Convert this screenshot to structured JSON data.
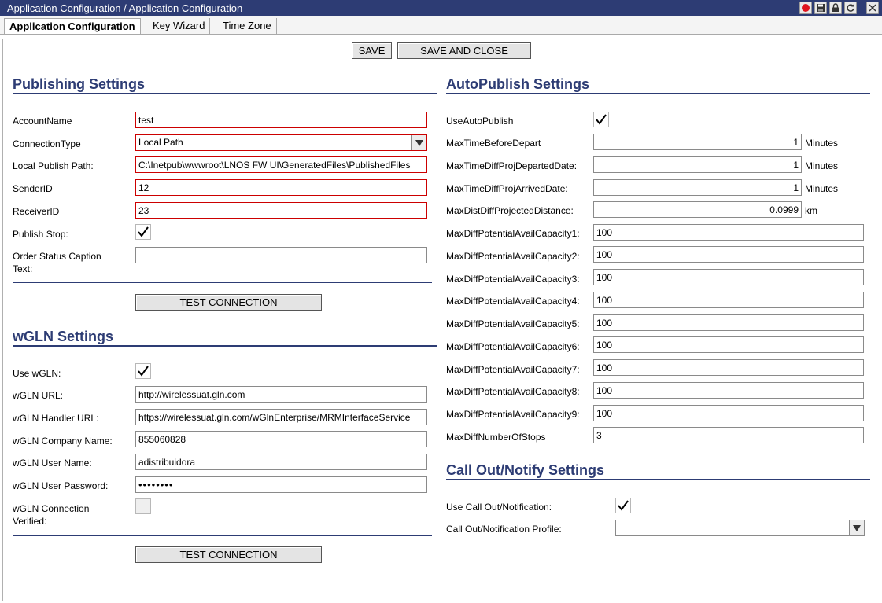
{
  "window": {
    "title": "Application Configuration / Application Configuration",
    "controls": [
      "record-icon",
      "save-icon",
      "lock-icon",
      "refresh-icon",
      "close-icon"
    ]
  },
  "tabs": [
    {
      "label": "Application Configuration",
      "active": true
    },
    {
      "label": "Key Wizard",
      "active": false
    },
    {
      "label": "Time Zone",
      "active": false
    }
  ],
  "toolbar": {
    "save_label": "SAVE",
    "save_close_label": "SAVE AND CLOSE"
  },
  "publishing": {
    "title": "Publishing Settings",
    "account_name": {
      "label": "AccountName",
      "value": "test"
    },
    "connection_type": {
      "label": "ConnectionType",
      "value": "Local Path"
    },
    "local_publish_path": {
      "label": "Local Publish Path:",
      "value": "C:\\Inetpub\\wwwroot\\LNOS FW UI\\GeneratedFiles\\PublishedFiles"
    },
    "sender_id": {
      "label": "SenderID",
      "value": "12"
    },
    "receiver_id": {
      "label": "ReceiverID",
      "value": "23"
    },
    "publish_stop": {
      "label": "Publish Stop:",
      "checked": true
    },
    "order_status_caption": {
      "label": "Order Status Caption Text:",
      "value": ""
    },
    "test_label": "TEST CONNECTION"
  },
  "wgln": {
    "title": "wGLN Settings",
    "use_wgln": {
      "label": "Use wGLN:",
      "checked": true
    },
    "url": {
      "label": "wGLN URL:",
      "value": "http://wirelessuat.gln.com"
    },
    "handler_url": {
      "label": "wGLN Handler URL:",
      "value": "https://wirelessuat.gln.com/wGlnEnterprise/MRMInterfaceService"
    },
    "company_name": {
      "label": "wGLN Company Name:",
      "value": "855060828"
    },
    "user_name": {
      "label": "wGLN User Name:",
      "value": "adistribuidora"
    },
    "user_password": {
      "label": "wGLN User Password:",
      "value": "••••••••"
    },
    "connection_verified": {
      "label": "wGLN Connection Verified:",
      "checked": false
    },
    "test_label": "TEST CONNECTION"
  },
  "autopublish": {
    "title": "AutoPublish Settings",
    "use_autopublish": {
      "label": "UseAutoPublish",
      "checked": true
    },
    "max_time_before_depart": {
      "label": "MaxTimeBeforeDepart",
      "value": "1",
      "unit": "Minutes"
    },
    "max_time_diff_departed": {
      "label": "MaxTimeDiffProjDepartedDate:",
      "value": "1",
      "unit": "Minutes"
    },
    "max_time_diff_arrived": {
      "label": "MaxTimeDiffProjArrivedDate:",
      "value": "1",
      "unit": "Minutes"
    },
    "max_dist_diff": {
      "label": "MaxDistDiffProjectedDistance:",
      "value": "0.0999",
      "unit": "km"
    },
    "capacity": [
      {
        "label": "MaxDiffPotentialAvailCapacity1:",
        "value": "100"
      },
      {
        "label": "MaxDiffPotentialAvailCapacity2:",
        "value": "100"
      },
      {
        "label": "MaxDiffPotentialAvailCapacity3:",
        "value": "100"
      },
      {
        "label": "MaxDiffPotentialAvailCapacity4:",
        "value": "100"
      },
      {
        "label": "MaxDiffPotentialAvailCapacity5:",
        "value": "100"
      },
      {
        "label": "MaxDiffPotentialAvailCapacity6:",
        "value": "100"
      },
      {
        "label": "MaxDiffPotentialAvailCapacity7:",
        "value": "100"
      },
      {
        "label": "MaxDiffPotentialAvailCapacity8:",
        "value": "100"
      },
      {
        "label": "MaxDiffPotentialAvailCapacity9:",
        "value": "100"
      }
    ],
    "max_diff_stops": {
      "label": "MaxDiffNumberOfStops",
      "value": "3"
    }
  },
  "callout": {
    "title": "Call Out/Notify Settings",
    "use_callout": {
      "label": "Use Call Out/Notification:",
      "checked": true
    },
    "profile": {
      "label": "Call Out/Notification Profile:",
      "value": ""
    }
  },
  "colors": {
    "title_bar": "#2d3c74",
    "section_title": "#2d3c74",
    "required_border": "#cc0000"
  }
}
